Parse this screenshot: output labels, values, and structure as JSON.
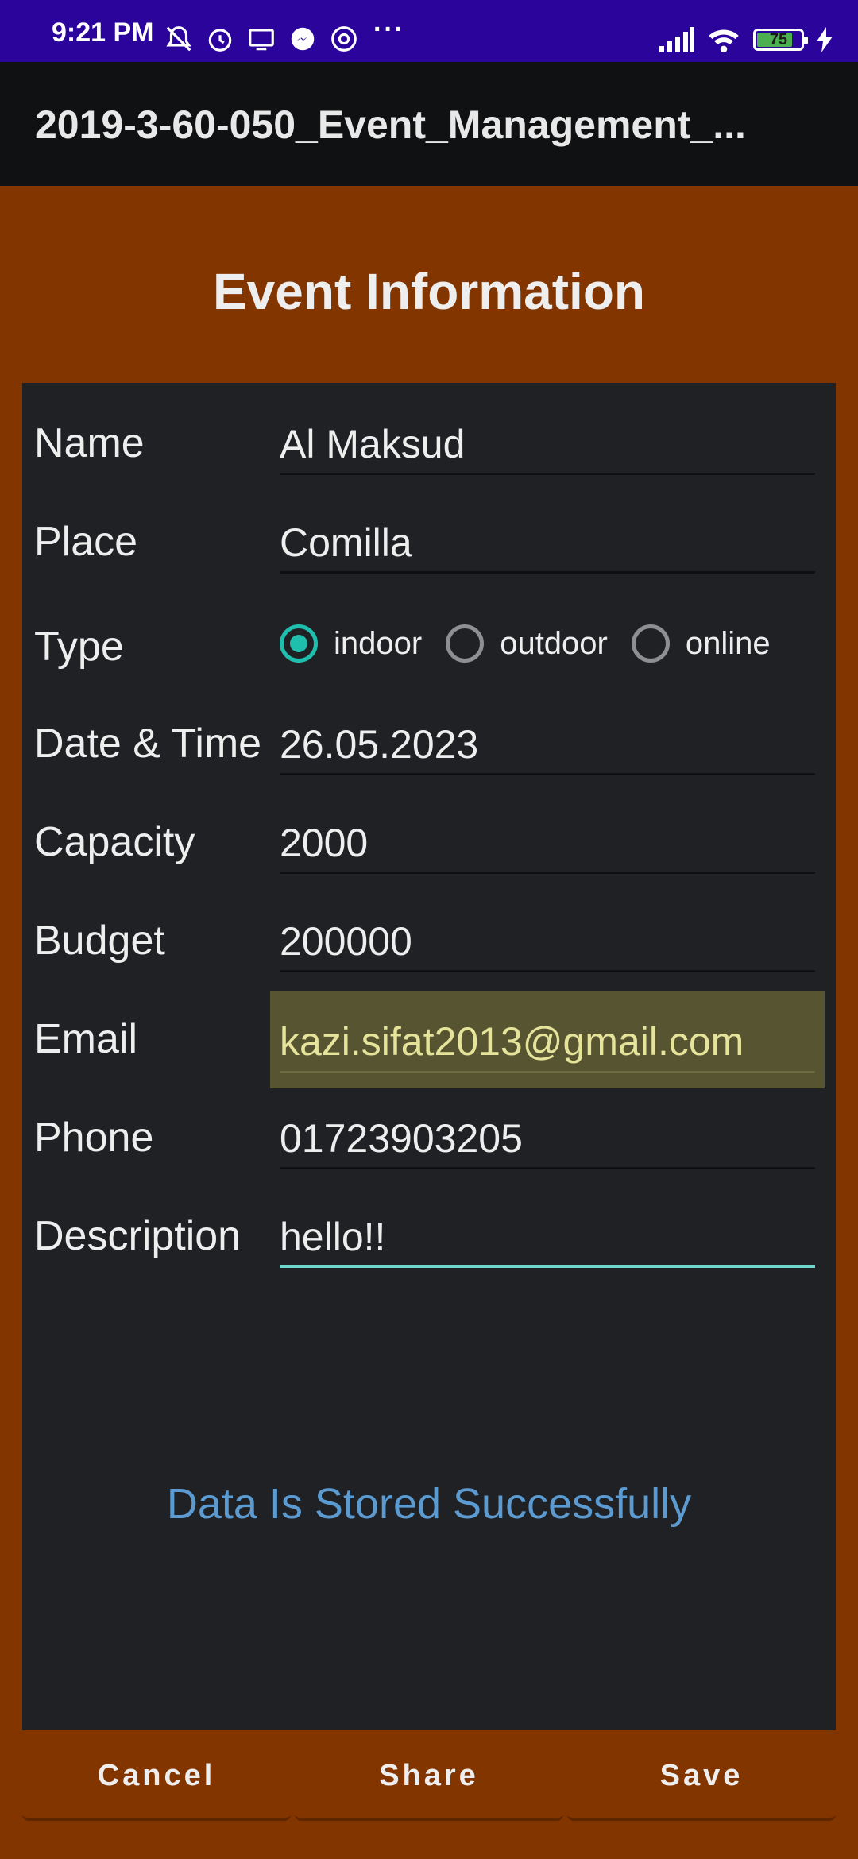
{
  "status_bar": {
    "time": "9:21 PM",
    "more": "···",
    "battery_level": "75",
    "icons": [
      "bell-off-icon",
      "alarm-icon",
      "screen-icon",
      "messenger-icon",
      "at-icon",
      "signal-icon",
      "wifi-icon",
      "battery-icon",
      "charging-icon"
    ]
  },
  "app_bar": {
    "title": "2019-3-60-050_Event_Management_..."
  },
  "heading": "Event Information",
  "form": {
    "name_label": "Name",
    "name_value": "Al Maksud",
    "place_label": "Place",
    "place_value": "Comilla",
    "type_label": "Type",
    "type_options": [
      "indoor",
      "outdoor",
      "online"
    ],
    "type_selected": "indoor",
    "datetime_label": "Date & Time",
    "datetime_value": "26.05.2023",
    "capacity_label": "Capacity",
    "capacity_value": "2000",
    "budget_label": "Budget",
    "budget_value": "200000",
    "email_label": "Email",
    "email_value": "kazi.sifat2013@gmail.com",
    "phone_label": "Phone",
    "phone_value": "01723903205",
    "description_label": "Description",
    "description_value": "hello!!"
  },
  "message": "Data Is Stored Successfully",
  "buttons": {
    "cancel": "Cancel",
    "share": "Share",
    "save": "Save"
  },
  "colors": {
    "status_bar": "#2a049b",
    "app_bar": "#101112",
    "background": "#833500",
    "card": "#1f2124",
    "accent": "#1fbfae",
    "message": "#5c9bd1",
    "highlight": "#565431"
  }
}
